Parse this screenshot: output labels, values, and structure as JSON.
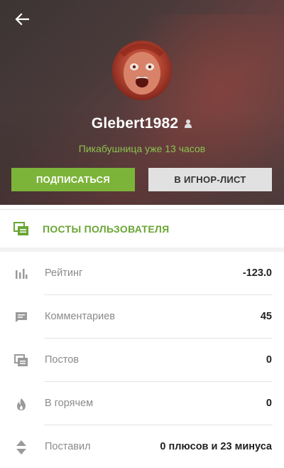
{
  "profile": {
    "username": "Glebert1982",
    "gender_icon": "female-user-icon",
    "subtitle": "Пикабушница уже 13 часов",
    "avatar_icon": "avatar-image"
  },
  "actions": {
    "subscribe_label": "ПОДПИСАТЬСЯ",
    "ignore_label": "В ИГНОР-ЛИСТ"
  },
  "posts_link": {
    "label": "ПОСТЫ ПОЛЬЗОВАТЕЛЯ",
    "icon": "posts-stack-icon"
  },
  "stats": [
    {
      "icon": "bar-chart-icon",
      "label": "Рейтинг",
      "value": "-123.0"
    },
    {
      "icon": "comment-icon",
      "label": "Комментариев",
      "value": "45"
    },
    {
      "icon": "posts-stack-icon",
      "label": "Постов",
      "value": "0"
    },
    {
      "icon": "flame-icon",
      "label": "В горячем",
      "value": "0"
    },
    {
      "icon": "up-down-arrows-icon",
      "label": "Поставил",
      "value": "0 плюсов и 23 минуса"
    }
  ],
  "colors": {
    "accent_green": "#7cb43a",
    "subtitle_green": "#8cc24f",
    "icon_gray": "#9a9a9a"
  }
}
